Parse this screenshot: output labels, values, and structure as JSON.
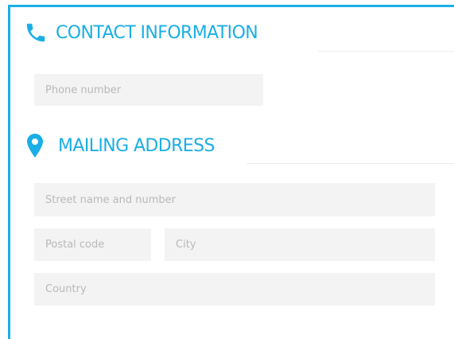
{
  "contact": {
    "title": "CONTACT INFORMATION",
    "icon": "phone-icon",
    "phone_placeholder": "Phone number"
  },
  "mailing": {
    "title": "MAILING ADDRESS",
    "icon": "location-pin-icon",
    "street_placeholder": "Street name and number",
    "postal_placeholder": "Postal code",
    "city_placeholder": "City",
    "country_placeholder": "Country"
  },
  "colors": {
    "accent": "#1aaee6",
    "field_bg": "#f3f3f3",
    "placeholder": "#b9b9b9"
  }
}
